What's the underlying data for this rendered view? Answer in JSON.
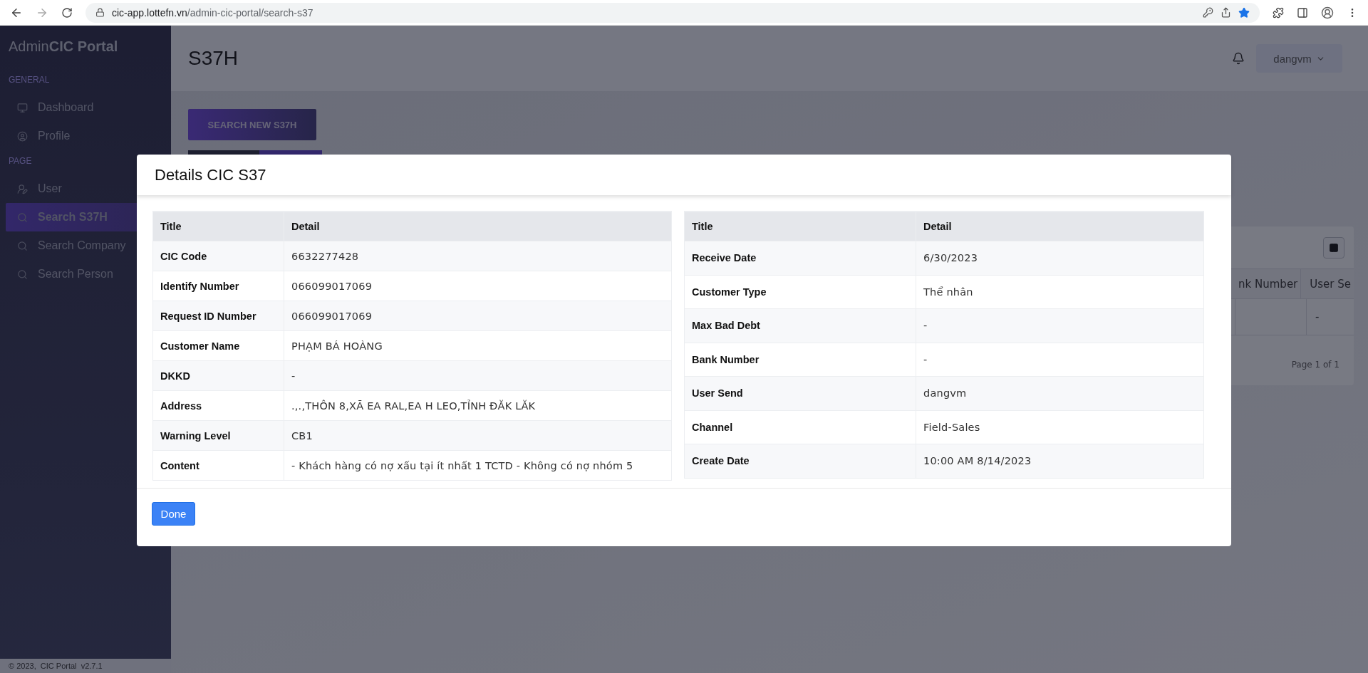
{
  "browser": {
    "url_host": "cic-app.lottefn.vn",
    "url_path": "/admin-cic-portal/search-s37"
  },
  "sidebar": {
    "brand_regular": "Admin",
    "brand_bold": "CIC Portal",
    "sections": [
      {
        "heading": "GENERAL",
        "items": [
          {
            "label": "Dashboard",
            "selected": false
          },
          {
            "label": "Profile",
            "selected": false
          }
        ]
      },
      {
        "heading": "PAGE",
        "items": [
          {
            "label": "User",
            "selected": false
          },
          {
            "label": "Search S37H",
            "selected": true
          },
          {
            "label": "Search Company",
            "selected": false
          },
          {
            "label": "Search Person",
            "selected": false
          }
        ]
      }
    ],
    "footer": "© 2023,  CIC Portal  v2.7.1"
  },
  "header": {
    "title": "S37H",
    "user": "dangvm"
  },
  "search_button": "SEARCH NEW S37H",
  "background_table": {
    "columns": [
      "nk Number",
      "User Se"
    ],
    "rows": [
      [
        "",
        "-"
      ]
    ],
    "pagination": "Page 1 of 1"
  },
  "modal": {
    "title": "Details CIC S37",
    "left_table": {
      "columns": [
        "Title",
        "Detail"
      ],
      "rows": [
        [
          "CIC Code",
          "6632277428"
        ],
        [
          "Identify Number",
          "066099017069"
        ],
        [
          "Request ID Number",
          "066099017069"
        ],
        [
          "Customer Name",
          "PHẠM BÁ HOÀNG"
        ],
        [
          "DKKD",
          "-"
        ],
        [
          "Address",
          ".,.,THÔN 8,XÃ EA RAL,EA H LEO,TỈNH ĐĂK LĂK"
        ],
        [
          "Warning Level",
          "CB1"
        ],
        [
          "Content",
          "- Khách hàng có nợ xấu tại ít nhất 1 TCTD - Không có nợ nhóm 5"
        ]
      ]
    },
    "right_table": {
      "columns": [
        "Title",
        "Detail"
      ],
      "rows": [
        [
          "Receive Date",
          "6/30/2023"
        ],
        [
          "Customer Type",
          "Thể nhân"
        ],
        [
          "Max Bad Debt",
          "-"
        ],
        [
          "Bank Number",
          "-"
        ],
        [
          "User Send",
          "dangvm"
        ],
        [
          "Channel",
          "Field-Sales"
        ],
        [
          "Create Date",
          "10:00 AM 8/14/2023"
        ]
      ]
    },
    "done": "Done"
  }
}
